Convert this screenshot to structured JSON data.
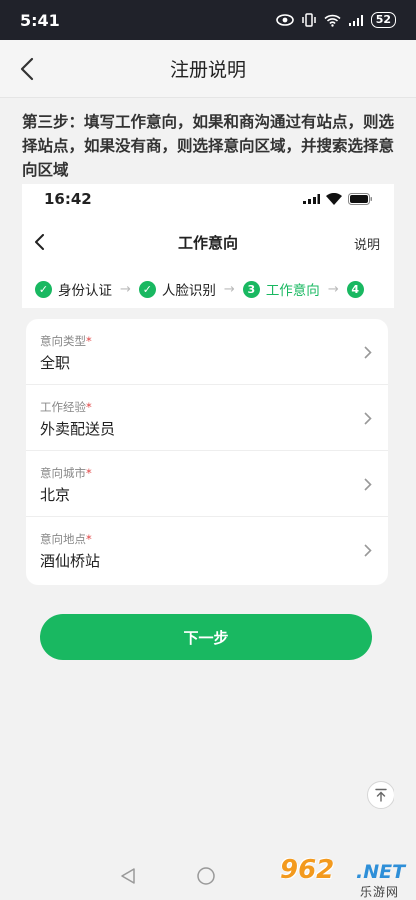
{
  "status_bar": {
    "time": "5:41",
    "battery": "52"
  },
  "app_bar": {
    "title": "注册说明"
  },
  "step_description": "第三步：填写工作意向，如果和商沟通过有站点，则选择站点，如果没有商，则选择意向区域，并搜索选择意向区域",
  "phone": {
    "time": "16:42",
    "nav_title": "工作意向",
    "help_label": "说明",
    "steps": [
      {
        "index": "✓",
        "label": "身份认证",
        "state": "done"
      },
      {
        "index": "✓",
        "label": "人脸识别",
        "state": "done"
      },
      {
        "index": "3",
        "label": "工作意向",
        "state": "active"
      },
      {
        "index": "4",
        "label": "",
        "state": "pending"
      }
    ],
    "step_arrow": "→",
    "form": [
      {
        "label": "意向类型",
        "required": "*",
        "value": "全职"
      },
      {
        "label": "工作经验",
        "required": "*",
        "value": "外卖配送员"
      },
      {
        "label": "意向城市",
        "required": "*",
        "value": "北京"
      },
      {
        "label": "意向地点",
        "required": "*",
        "value": "酒仙桥站"
      }
    ],
    "next_button": "下一步"
  },
  "watermark": {
    "number": "962",
    "domain": ".NET",
    "chinese": "乐游网"
  },
  "icons": {
    "back": "chevron-left-icon",
    "chevron": "chevron-right-icon",
    "check": "check-circle-icon",
    "to_top": "arrow-up-to-top-icon",
    "nav_back": "triangle-back-icon",
    "nav_home": "circle-home-icon"
  },
  "colors": {
    "accent": "#19b861",
    "required": "#e04444",
    "statusbar": "#20222a"
  }
}
